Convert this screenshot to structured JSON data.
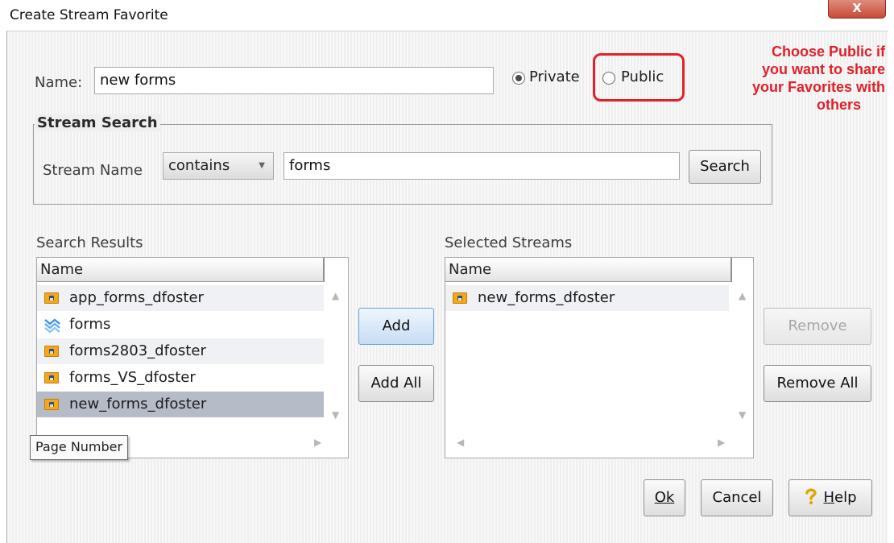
{
  "window": {
    "title": "Create Stream Favorite",
    "close_glyph": "X"
  },
  "favorite": {
    "name_label": "Name:",
    "name_value": "new forms",
    "visibility_options": [
      {
        "label": "Private",
        "checked": true
      },
      {
        "label": "Public",
        "checked": false
      }
    ]
  },
  "annotation": {
    "lines": [
      "Choose Public if",
      "you want to share",
      "your Favorites with",
      "others"
    ],
    "color": "#e0202a"
  },
  "stream_search": {
    "title": "Stream Search",
    "field_label": "Stream Name",
    "operator": "contains",
    "query": "forms",
    "search_button": "Search"
  },
  "search_results": {
    "label": "Search Results",
    "column": "Name",
    "items": [
      {
        "name": "app_forms_dfoster",
        "icon": "folder-user-icon"
      },
      {
        "name": "forms",
        "icon": "stream-icon"
      },
      {
        "name": "forms2803_dfoster",
        "icon": "folder-user-icon"
      },
      {
        "name": "forms_VS_dfoster",
        "icon": "folder-user-icon"
      },
      {
        "name": "new_forms_dfoster",
        "icon": "folder-user-icon",
        "selected": true
      }
    ],
    "tooltip": "Page Number"
  },
  "transfer_buttons": {
    "add": "Add",
    "add_all": "Add All",
    "remove": "Remove",
    "remove_all": "Remove All"
  },
  "selected_streams": {
    "label": "Selected Streams",
    "column": "Name",
    "items": [
      {
        "name": "new_forms_dfoster",
        "icon": "folder-user-icon"
      }
    ]
  },
  "footer": {
    "ok": "Ok",
    "ok_rest": "k",
    "cancel": "Cancel",
    "help_first": "H",
    "help_rest": "elp"
  }
}
